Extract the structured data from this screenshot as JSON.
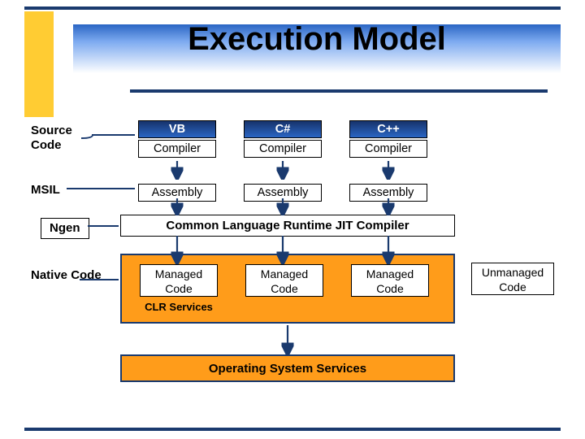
{
  "title": "Execution Model",
  "labels": {
    "source": "Source Code",
    "msil": "MSIL",
    "ngen": "Ngen",
    "native": "Native Code"
  },
  "langs": {
    "vb": "VB",
    "cs": "C#",
    "cpp": "C++"
  },
  "compiler": "Compiler",
  "assembly": "Assembly",
  "jit": "Common Language Runtime JIT Compiler",
  "managed": "Managed\nCode",
  "clr_services": "CLR Services",
  "unmanaged": "Unmanaged\nCode",
  "os": "Operating System Services"
}
